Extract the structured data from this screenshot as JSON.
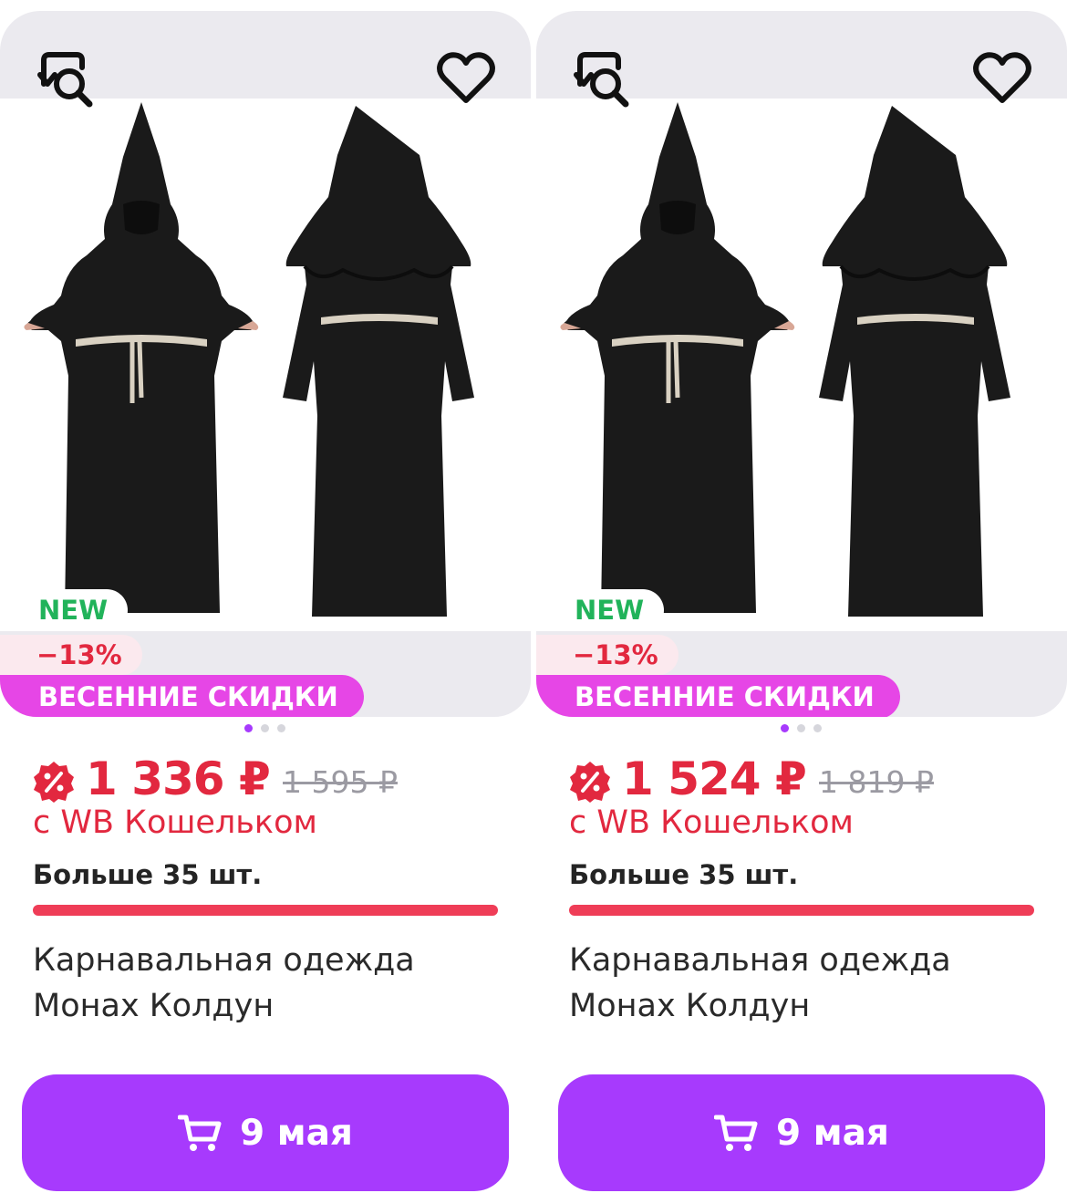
{
  "theme": {
    "accent": "#a73afd",
    "price_red": "#e2283f",
    "promo_pink": "#e646e6",
    "new_green": "#21b35a",
    "stock_bar": "#ef3d57"
  },
  "icons": {
    "similar": "search-similar-icon",
    "favorite": "heart-icon",
    "sale": "percent-badge-icon",
    "cart": "cart-icon"
  },
  "products": [
    {
      "badge_new": "NEW",
      "badge_discount": "−13%",
      "badge_promo": "ВЕСЕННИЕ СКИДКИ",
      "price": "1 336 ₽",
      "old_price": "1 595 ₽",
      "wallet_note": "с WB Кошельком",
      "stock": "Больше 35 шт.",
      "title_line1": "Карнавальная одежда",
      "title_line2": "Монах Колдун",
      "delivery": "9 мая",
      "carousel": {
        "count": 3,
        "active": 0
      }
    },
    {
      "badge_new": "NEW",
      "badge_discount": "−13%",
      "badge_promo": "ВЕСЕННИЕ СКИДКИ",
      "price": "1 524 ₽",
      "old_price": "1 819 ₽",
      "wallet_note": "с WB Кошельком",
      "stock": "Больше 35 шт.",
      "title_line1": "Карнавальная одежда",
      "title_line2": "Монах Колдун",
      "delivery": "9 мая",
      "carousel": {
        "count": 3,
        "active": 0
      }
    }
  ]
}
